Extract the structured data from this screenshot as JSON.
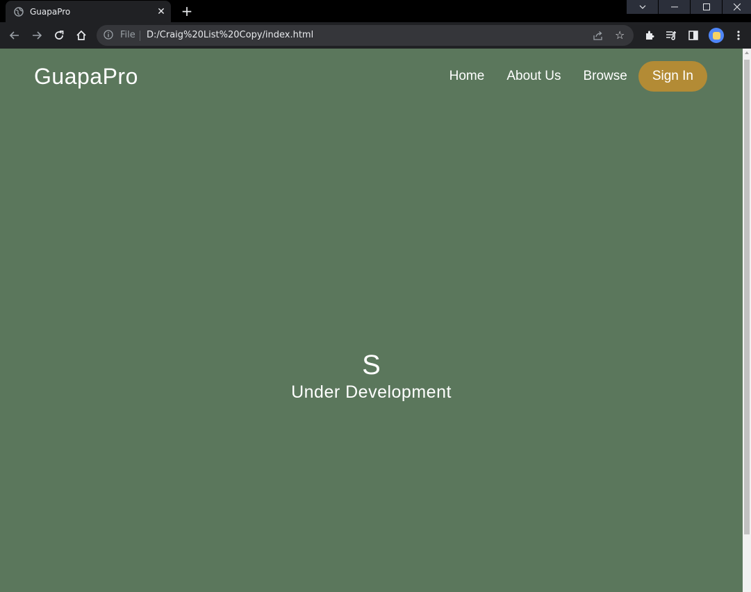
{
  "browser": {
    "tab_title": "GuapaPro",
    "new_tab_symbol": "+",
    "close_symbol": "✕",
    "scheme_label": "File",
    "url": "D:/Craig%20List%20Copy/index.html",
    "star_symbol": "☆",
    "icons": [
      "globe-icon",
      "back-icon",
      "forward-icon",
      "reload-icon",
      "home-icon",
      "info-icon",
      "share-icon",
      "star-icon",
      "extensions-icon",
      "media-icon",
      "sidepanel-icon",
      "profile-avatar",
      "menu-icon"
    ]
  },
  "site": {
    "logo": "GuapaPro",
    "nav": {
      "home": "Home",
      "about": "About Us",
      "browse": "Browse",
      "sign_in": "Sign In"
    },
    "hero": {
      "letter": "S",
      "status": "Under Development"
    }
  },
  "colors": {
    "page_bg": "#5b775c",
    "accent": "#b38b35",
    "chrome_dark": "#202124"
  }
}
